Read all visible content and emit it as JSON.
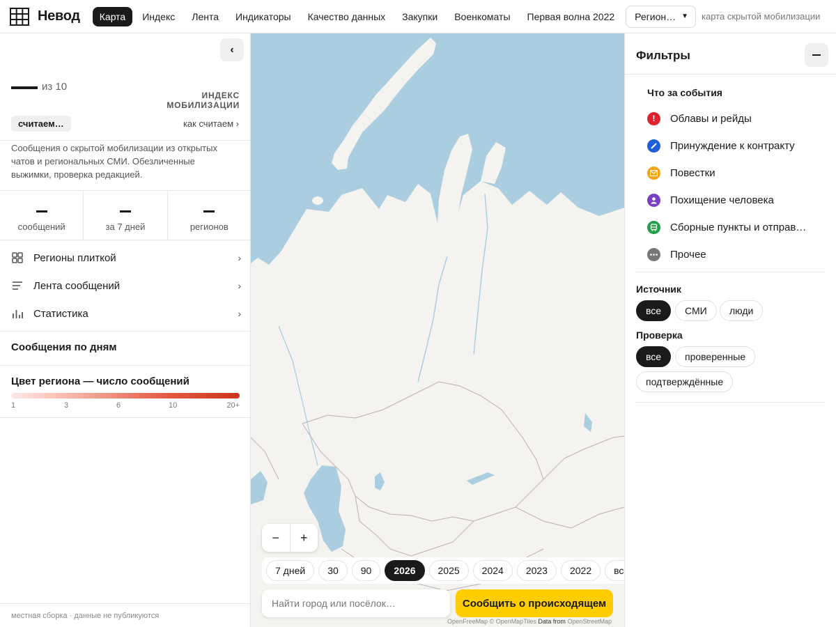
{
  "header": {
    "brand": "Невод",
    "nav": [
      {
        "label": "Карта",
        "active": true
      },
      {
        "label": "Индекс",
        "active": false
      },
      {
        "label": "Лента",
        "active": false
      },
      {
        "label": "Индикаторы",
        "active": false
      },
      {
        "label": "Качество данных",
        "active": false
      },
      {
        "label": "Закупки",
        "active": false
      },
      {
        "label": "Военкоматы",
        "active": false
      },
      {
        "label": "Первая волна 2022",
        "active": false
      }
    ],
    "region_select": "Регион…",
    "tagline": "карта скрытой мобилизации"
  },
  "left_panel": {
    "index_of": "из 10",
    "index_label": "ИНДЕКС МОБИЛИЗАЦИИ",
    "counting": "считаем…",
    "how_link": "как считаем ›",
    "description": "Сообщения о скрытой мобилизации из открытых чатов и региональных СМИ. Обезличенные выжимки, проверка редакцией.",
    "stats": [
      {
        "label": "сообщений"
      },
      {
        "label": "за 7 дней"
      },
      {
        "label": "регионов"
      }
    ],
    "menu": [
      {
        "label": "Регионы плиткой",
        "icon": "grid-icon"
      },
      {
        "label": "Лента сообщений",
        "icon": "list-icon"
      },
      {
        "label": "Статистика",
        "icon": "bar-chart-icon"
      }
    ],
    "by_days_title": "Сообщения по дням",
    "legend_title": "Цвет региона — число сообщений",
    "legend_ticks": [
      "1",
      "3",
      "6",
      "10",
      "20+"
    ],
    "footer_note": "местная сборка · данные не публикуются"
  },
  "map": {
    "zoom_out": "−",
    "zoom_in": "+",
    "years": [
      {
        "label": "7 дней",
        "active": false
      },
      {
        "label": "30",
        "active": false
      },
      {
        "label": "90",
        "active": false
      },
      {
        "label": "2026",
        "active": true
      },
      {
        "label": "2025",
        "active": false
      },
      {
        "label": "2024",
        "active": false
      },
      {
        "label": "2023",
        "active": false
      },
      {
        "label": "2022",
        "active": false
      },
      {
        "label": "всё в",
        "active": false
      }
    ],
    "search_placeholder": "Найти город или посёлок…",
    "report_button": "Сообщить о происходящем",
    "attribution_a": "OpenFreeMap © OpenMapTiles",
    "attribution_b": "Data from",
    "attribution_c": "OpenStreetMap",
    "colors": {
      "water": "#aacde0",
      "land": "#f5f3ef",
      "border": "#b8b0b8"
    }
  },
  "filters": {
    "title": "Фильтры",
    "events_title": "Что за события",
    "events": [
      {
        "label": "Облавы и рейды",
        "color": "#e0202a",
        "icon": "exclamation-icon"
      },
      {
        "label": "Принуждение к контракту",
        "color": "#1f5fd6",
        "icon": "pen-icon"
      },
      {
        "label": "Повестки",
        "color": "#f5a315",
        "icon": "envelope-icon"
      },
      {
        "label": "Похищение человека",
        "color": "#7b3fc4",
        "icon": "person-icon"
      },
      {
        "label": "Сборные пункты и отправ…",
        "color": "#21a048",
        "icon": "bus-icon"
      },
      {
        "label": "Прочее",
        "color": "#777777",
        "icon": "dots-icon"
      }
    ],
    "source_title": "Источник",
    "source_options": [
      {
        "label": "все",
        "active": true
      },
      {
        "label": "СМИ",
        "active": false
      },
      {
        "label": "люди",
        "active": false
      }
    ],
    "check_title": "Проверка",
    "check_options": [
      {
        "label": "все",
        "active": true
      },
      {
        "label": "проверенные",
        "active": false
      },
      {
        "label": "подтверждённые",
        "active": false
      }
    ]
  }
}
